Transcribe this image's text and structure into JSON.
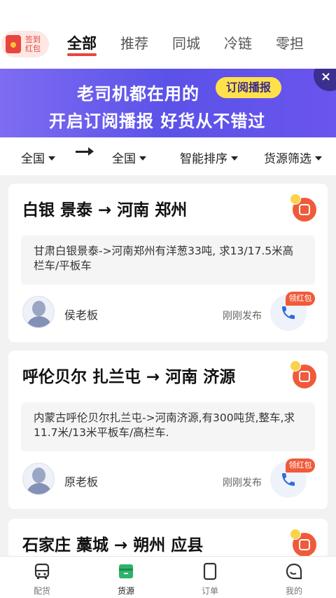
{
  "checkin": {
    "label": "签到红包"
  },
  "tabs": [
    {
      "label": "全部",
      "active": true
    },
    {
      "label": "推荐"
    },
    {
      "label": "同城"
    },
    {
      "label": "冷链"
    },
    {
      "label": "零担"
    }
  ],
  "banner": {
    "line1": "老司机都在用的",
    "pill": "订阅播报",
    "line2": "开启订阅播报 好货从不错过",
    "close": "×"
  },
  "filters": {
    "from": "全国",
    "to": "全国",
    "sort": "智能排序",
    "filter": "货源筛选"
  },
  "cards": [
    {
      "route": "白银 景泰 → 河南 郑州",
      "desc": "甘肃白银景泰->河南郑州有洋葱33吨, 求13/17.5米高栏车/平板车",
      "owner": "侯老板",
      "time": "刚刚发布",
      "badge": "领红包"
    },
    {
      "route": "呼伦贝尔 扎兰屯 → 河南 济源",
      "desc": "内蒙古呼伦贝尔扎兰屯->河南济源,有300吨货,整车,求11.7米/13米平板车/高栏车.",
      "owner": "原老板",
      "time": "刚刚发布",
      "badge": "领红包"
    },
    {
      "route": "石家庄 藁城 → 朔州 应县"
    }
  ],
  "bottom_nav": [
    {
      "label": "配货",
      "icon": "truck-icon"
    },
    {
      "label": "货源",
      "icon": "cargo-box-icon",
      "active": true
    },
    {
      "label": "订单",
      "icon": "order-icon"
    },
    {
      "label": "我的",
      "icon": "profile-icon"
    }
  ],
  "colors": {
    "accent": "#e8453c",
    "banner": "#6a5cf0",
    "phone": "#2f6bd9"
  }
}
